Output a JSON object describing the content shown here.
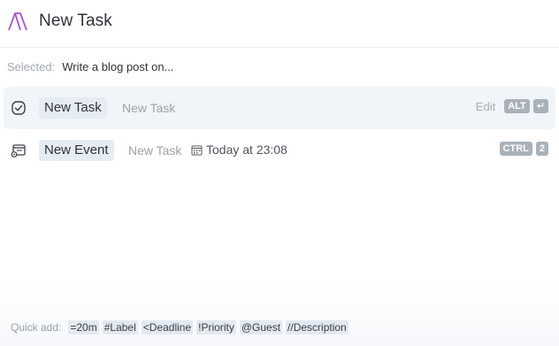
{
  "header": {
    "title": "New Task",
    "logo_icon": "app-logo-icon"
  },
  "selected": {
    "label": "Selected:",
    "value": "Write a blog post on..."
  },
  "commands": [
    {
      "icon": "checkbox-circle-icon",
      "chip": "New Task",
      "subtitle": "New Task",
      "edit_label": "Edit",
      "shortcut": [
        "ALT",
        "↵"
      ]
    },
    {
      "icon": "calendar-event-icon",
      "chip": "New Event",
      "subtitle": "New Task",
      "meta": "Today at 23:08",
      "meta_icon": "calendar-icon",
      "shortcut": [
        "CTRL",
        "2"
      ]
    }
  ],
  "quick_add": {
    "label": "Quick add:",
    "tokens": [
      "=20m",
      "#Label",
      "<Deadline",
      "!Priority",
      "@Guest",
      "//Description"
    ]
  },
  "colors": {
    "accent": "#a64fd6",
    "chip_bg": "#e5ecf3",
    "kbd_bg": "#a9b1ba",
    "active_row": "#f1f5f9"
  }
}
